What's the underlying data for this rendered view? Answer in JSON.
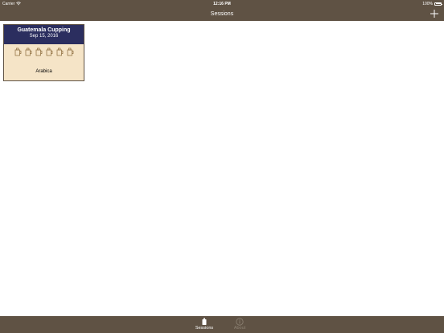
{
  "status_bar": {
    "carrier": "Carrier",
    "time": "12:16 PM",
    "battery": "100%",
    "battery_level": 1.0
  },
  "nav": {
    "title": "Sessions",
    "add_icon": "plus-icon"
  },
  "sessions": [
    {
      "title": "Guatemala Cupping",
      "date": "Sep 15, 2016",
      "cup_count": 6,
      "cup_icon": "coffee-cup-icon",
      "bean_type": "Arabica"
    }
  ],
  "tabs": [
    {
      "label": "Sessions",
      "icon": "cup-icon",
      "selected": true
    },
    {
      "label": "About",
      "icon": "info-icon",
      "selected": false
    }
  ],
  "colors": {
    "bar_background": "#5f5244",
    "card_header": "#2b2e5f",
    "card_body": "#f5e4c7",
    "tab_selected": "#ffffff",
    "tab_unselected": "#8d8274"
  }
}
